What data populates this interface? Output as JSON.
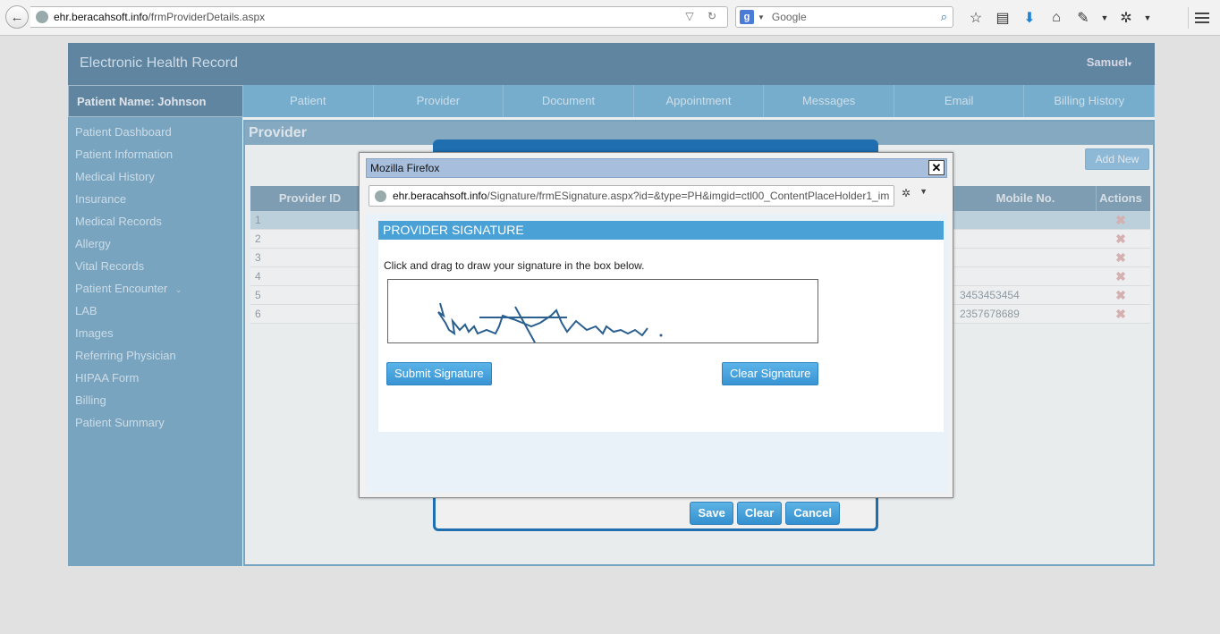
{
  "browser": {
    "url_host": "ehr.beracahsoft.info",
    "url_path": "/frmProviderDetails.aspx",
    "search_placeholder": "Google",
    "search_engine_letter": "g"
  },
  "app": {
    "title": "Electronic Health Record",
    "user": "Samuel",
    "patient_label": "Patient Name: Johnson",
    "tabs": [
      "Patient",
      "Provider",
      "Document",
      "Appointment",
      "Messages",
      "Email",
      "Billing History"
    ],
    "sidebar": [
      "Patient Dashboard",
      "Patient Information",
      "Medical History",
      "Insurance",
      "Medical Records",
      "Allergy",
      "Vital Records",
      "Patient Encounter",
      "LAB",
      "Images",
      "Referring Physician",
      "HIPAA Form",
      "Billing",
      "Patient Summary"
    ],
    "content_title": "Provider",
    "add_new": "Add New",
    "grid": {
      "headers": [
        "Provider ID",
        "Mobile No.",
        "Actions"
      ],
      "rows": [
        {
          "id": "1",
          "mobile": ""
        },
        {
          "id": "2",
          "mobile": ""
        },
        {
          "id": "3",
          "mobile": ""
        },
        {
          "id": "4",
          "mobile": ""
        },
        {
          "id": "5",
          "mobile": "3453453454"
        },
        {
          "id": "6",
          "mobile": "2357678689"
        }
      ]
    }
  },
  "under_dialog": {
    "buttons": [
      "Save",
      "Clear",
      "Cancel"
    ]
  },
  "popup": {
    "window_title": "Mozilla Firefox",
    "url_host": "ehr.beracahsoft.info",
    "url_path": "/Signature/frmESignature.aspx?id=&type=PH&imgid=ctl00_ContentPlaceHolder1_im",
    "panel_title": "PROVIDER SIGNATURE",
    "instructions": "Click and drag to draw your signature in the box below.",
    "submit_label": "Submit Signature",
    "clear_label": "Clear Signature"
  }
}
